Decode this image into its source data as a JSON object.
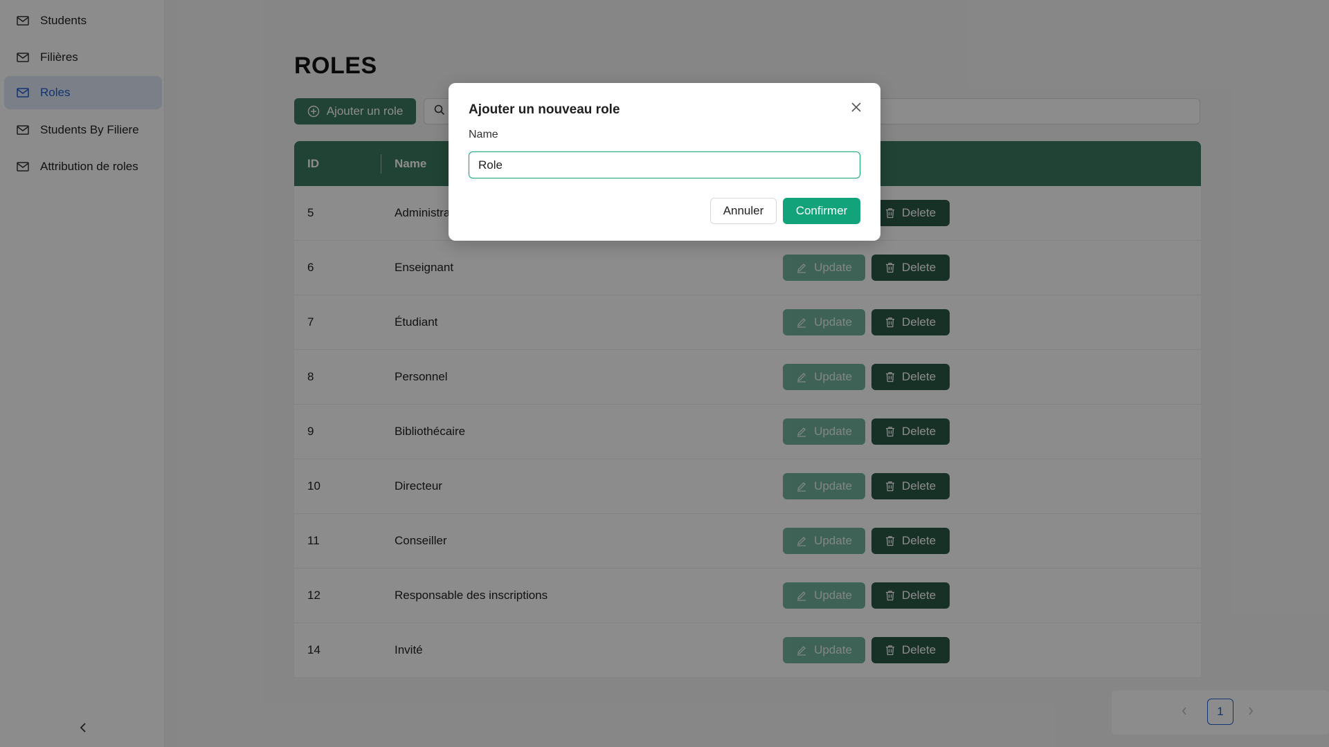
{
  "sidebar": {
    "items": [
      {
        "label": "Students",
        "icon": "mail-icon"
      },
      {
        "label": "Filières",
        "icon": "mail-icon"
      },
      {
        "label": "Roles",
        "icon": "mail-icon",
        "active": true
      },
      {
        "label": "Students By Filiere",
        "icon": "mail-icon"
      },
      {
        "label": "Attribution de roles",
        "icon": "mail-icon"
      }
    ],
    "collapse_icon": "chevron-left-icon"
  },
  "main": {
    "title": "ROLES",
    "add_button": "Ajouter un role",
    "search": {
      "placeholder": "",
      "value": ""
    },
    "table": {
      "columns": [
        "ID",
        "Name"
      ],
      "rows": [
        {
          "id": "5",
          "name": "Administrateur"
        },
        {
          "id": "6",
          "name": "Enseignant"
        },
        {
          "id": "7",
          "name": "Étudiant"
        },
        {
          "id": "8",
          "name": "Personnel"
        },
        {
          "id": "9",
          "name": "Bibliothécaire"
        },
        {
          "id": "10",
          "name": "Directeur"
        },
        {
          "id": "11",
          "name": "Conseiller"
        },
        {
          "id": "12",
          "name": "Responsable des inscriptions"
        },
        {
          "id": "14",
          "name": "Invité"
        }
      ],
      "update_label": "Update",
      "delete_label": "Delete"
    },
    "pagination": {
      "current": "1"
    }
  },
  "modal": {
    "title": "Ajouter un nouveau role",
    "field_label": "Name",
    "field_value": "Role",
    "cancel_label": "Annuler",
    "confirm_label": "Confirmer"
  },
  "colors": {
    "primary": "#3d7a62",
    "confirm": "#12a37b",
    "delete": "#2a5a48",
    "active_nav": "#1f5fd0"
  }
}
